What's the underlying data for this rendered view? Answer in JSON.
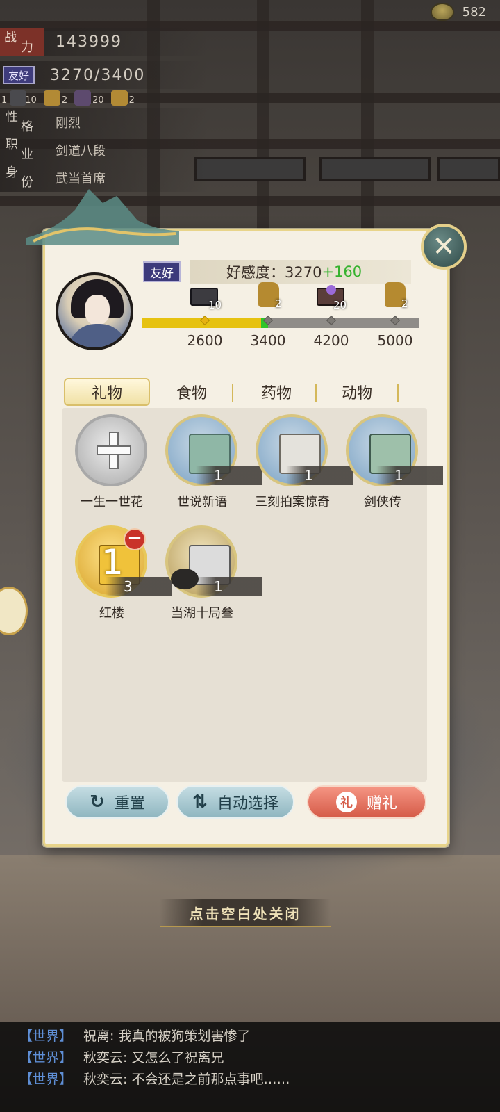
{
  "currency": {
    "icon": "teacup-icon",
    "value": "582"
  },
  "stats": {
    "power_label_1": "战",
    "power_label_2": "力",
    "power_value": "143999",
    "friend_badge": "友好",
    "favor_value": "3270/3400",
    "reward_items": [
      {
        "count_left": "1",
        "count": "10"
      },
      {
        "count": "2"
      },
      {
        "count": "20"
      },
      {
        "count": "2"
      }
    ],
    "personality_label": [
      "性",
      "格"
    ],
    "personality_value": "刚烈",
    "job_label": [
      "职",
      "业"
    ],
    "job_value": "剑道八段",
    "identity_label": [
      "身",
      "份"
    ],
    "identity_value": "武当首席"
  },
  "dialog": {
    "friend_badge": "友好",
    "affection_label": "好感度：3270",
    "affection_gain": "+160",
    "milestones": [
      {
        "value": "2600",
        "reward_count": "10",
        "reward_icon": "chest-icon"
      },
      {
        "value": "3400",
        "reward_count": "2",
        "reward_icon": "gold-ore-icon"
      },
      {
        "value": "4200",
        "reward_count": "20",
        "reward_icon": "purple-chest-icon"
      },
      {
        "value": "5000",
        "reward_count": "2",
        "reward_icon": "gold-ore-icon"
      }
    ],
    "progress_fraction": 0.43,
    "tabs": [
      "礼物",
      "食物",
      "药物",
      "动物"
    ],
    "items": [
      {
        "name": "一生一世花",
        "count": "",
        "icon": "plus-icon"
      },
      {
        "name": "世说新语",
        "count": "1",
        "icon": "book-icon"
      },
      {
        "name": "三刻拍案惊奇",
        "count": "1",
        "icon": "book-icon"
      },
      {
        "name": "剑侠传",
        "count": "1",
        "icon": "book-icon"
      },
      {
        "name": "红楼",
        "count": "3",
        "selected": "1",
        "icon": "gold-book-icon"
      },
      {
        "name": "当湖十局叁",
        "count": "1",
        "icon": "go-cards-icon"
      }
    ],
    "buttons": {
      "reset": "重置",
      "auto_select": "自动选择",
      "gift": "赠礼"
    }
  },
  "hint": "点击空白处关闭",
  "chat": [
    {
      "channel": "【世界】",
      "name": "祝离",
      "message": ": 我真的被狗策划害惨了"
    },
    {
      "channel": "【世界】",
      "name": "秋奕云",
      "message": ": 又怎么了祝离兄"
    },
    {
      "channel": "【世界】",
      "name": "秋奕云",
      "message": ": 不会还是之前那点事吧……"
    }
  ]
}
